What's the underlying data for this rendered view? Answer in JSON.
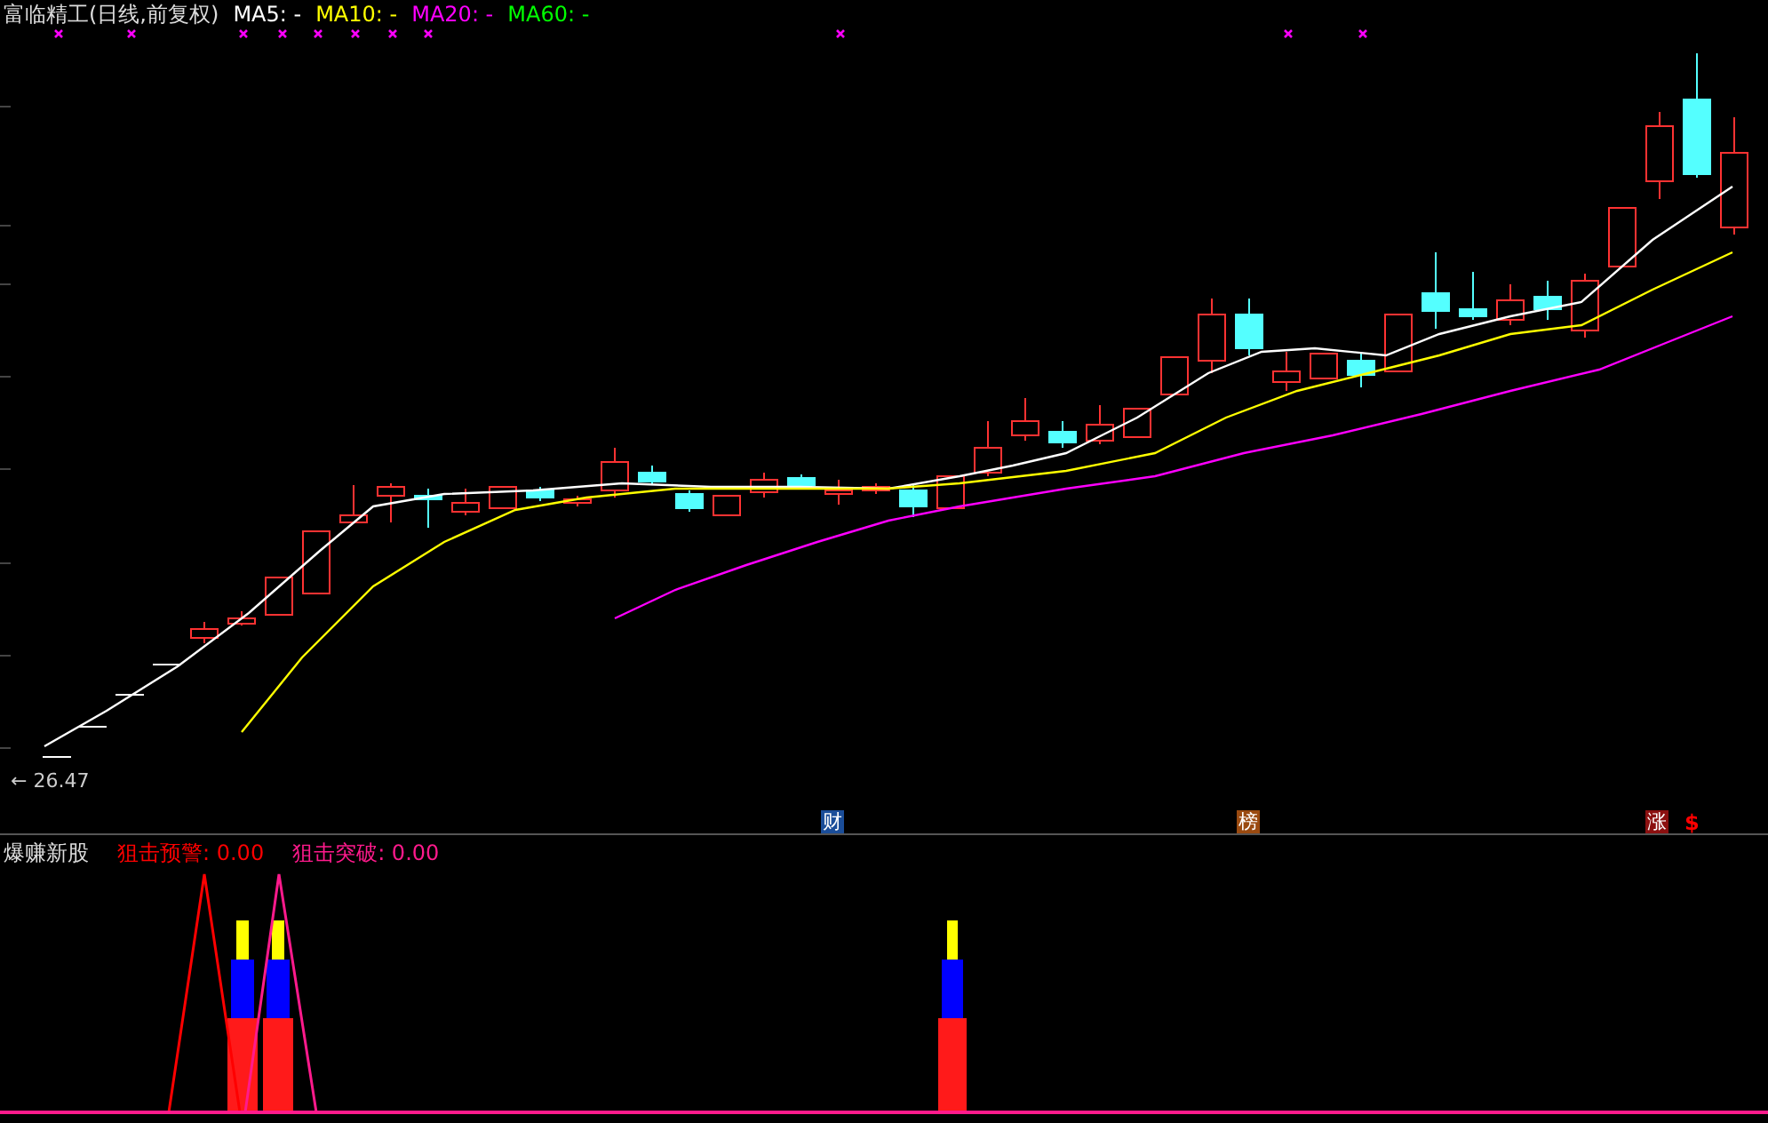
{
  "main_chart": {
    "title": "富临精工(日线,前复权)",
    "indicators": [
      {
        "label": "MA5:",
        "value": "-",
        "color": "#ffffff"
      },
      {
        "label": "MA10:",
        "value": "-",
        "color": "#ffff00"
      },
      {
        "label": "MA20:",
        "value": "-",
        "color": "#ff00ff"
      },
      {
        "label": "MA60:",
        "value": "-",
        "color": "#00ff00"
      }
    ],
    "low_marker": {
      "arrow": "←",
      "value": "26.47"
    },
    "event_badges": [
      {
        "text": "财",
        "color": "#1a4d99"
      },
      {
        "text": "榜",
        "color": "#9a4a10"
      },
      {
        "text": "涨",
        "color": "#8b1010"
      }
    ],
    "dollar_mark": "$"
  },
  "indicator_panel": {
    "title": "爆赚新股",
    "series": [
      {
        "label": "狙击预警:",
        "value": "0.00",
        "color": "#ff0000"
      },
      {
        "label": "狙击突破:",
        "value": "0.00",
        "color": "#ff1a8c"
      }
    ]
  }
}
